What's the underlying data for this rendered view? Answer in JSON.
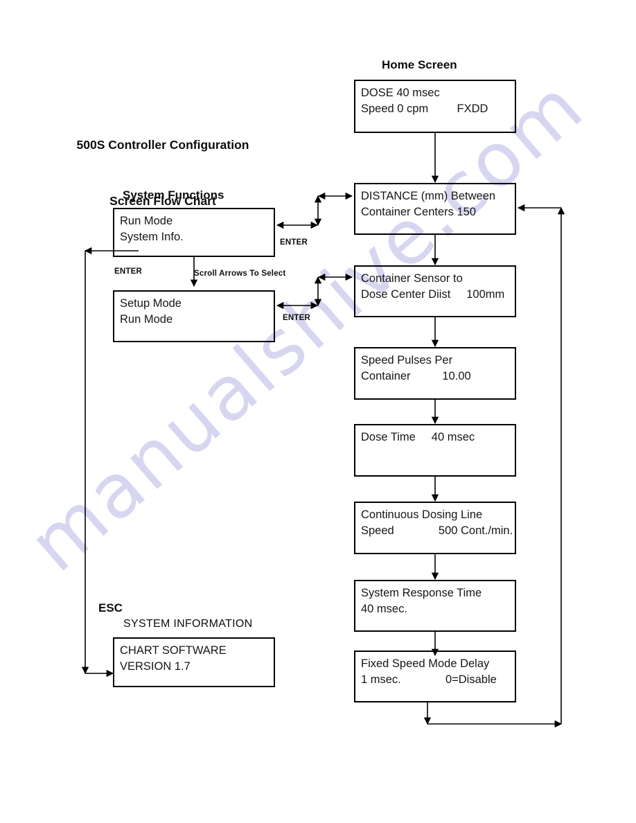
{
  "document": {
    "title_line1": "500S Controller Configuration",
    "title_line2": "Screen Flow Chart",
    "watermark": "manualshive.com",
    "watermark_color": "#d6d6f0",
    "page_background": "#ffffff",
    "line_color": "#000000"
  },
  "headings": {
    "home_screen": "Home Screen",
    "system_functions": "System Functions",
    "system_information": "SYSTEM INFORMATION",
    "esc": "ESC"
  },
  "edge_labels": {
    "enter_1": "ENTER",
    "enter_2": "ENTER",
    "enter_3": "ENTER",
    "enter_4": "ENTER",
    "scroll_arrows": "Scroll Arrows To Select"
  },
  "left_column": {
    "boxes": [
      {
        "id": "system-functions-menu",
        "line1": "Run Mode",
        "line2": "System Info."
      },
      {
        "id": "mode-select-menu",
        "line1": "Setup Mode",
        "line2": "Run Mode"
      },
      {
        "id": "system-information-screen",
        "line1": "CHART SOFTWARE",
        "line2": "VERSION 1.7"
      }
    ]
  },
  "right_column": {
    "boxes": [
      {
        "id": "home-screen",
        "line1": "DOSE 40 msec",
        "line2": "Speed 0 cpm         FXDD"
      },
      {
        "id": "distance-between-container-centers",
        "line1": "DISTANCE (mm) Between",
        "line2": "Container Centers 150"
      },
      {
        "id": "container-sensor-to-dose-center",
        "line1": "Container Sensor to",
        "line2": "Dose Center Diist     100mm"
      },
      {
        "id": "speed-pulses-per-container",
        "line1": "Speed Pulses Per",
        "line2": "Container          10.00"
      },
      {
        "id": "dose-time",
        "line1": "Dose Time     40 msec",
        "line2": ""
      },
      {
        "id": "continuous-dosing-line-speed",
        "line1": "Continuous Dosing Line",
        "line2": "Speed              500 Cont./min."
      },
      {
        "id": "system-response-time",
        "line1": "System Response Time",
        "line2": "40 msec."
      },
      {
        "id": "fixed-speed-mode-delay",
        "line1": "Fixed Speed Mode Delay",
        "line2": "1 msec.              0=Disable"
      }
    ]
  }
}
